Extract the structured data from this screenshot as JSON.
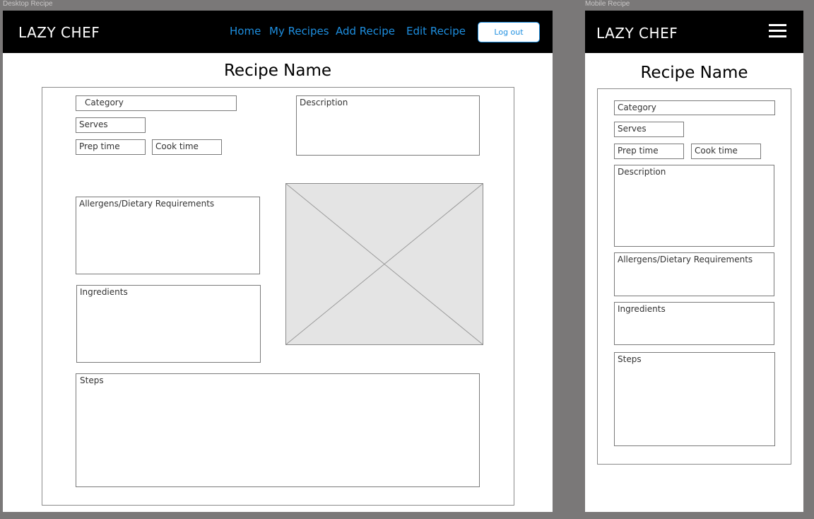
{
  "desktop": {
    "frame_label": "Desktop Recipe",
    "logo": "LAZY CHEF",
    "nav": [
      "Home",
      "My Recipes",
      "Add Recipe",
      "Edit Recipe"
    ],
    "logout_label": "Log out",
    "recipe_title": "Recipe Name",
    "fields": {
      "category": "Category",
      "serves": "Serves",
      "prep_time": "Prep time",
      "cook_time": "Cook time",
      "description": "Description",
      "allergens": "Allergens/Dietary Requirements",
      "ingredients": "Ingredients",
      "steps": "Steps"
    }
  },
  "mobile": {
    "frame_label": "Mobile Recipe",
    "logo": "LAZY CHEF",
    "recipe_title": "Recipe Name",
    "fields": {
      "category": "Category",
      "serves": "Serves",
      "prep_time": "Prep time",
      "cook_time": "Cook time",
      "description": "Description",
      "allergens": "Allergens/Dietary Requirements",
      "ingredients": "Ingredients",
      "steps": "Steps"
    }
  },
  "icons": {
    "menu": "hamburger-menu-icon",
    "image": "image-placeholder-icon"
  },
  "colors": {
    "link": "#1e8fe0",
    "topbar": "#000000",
    "canvas": "#7a7878"
  }
}
